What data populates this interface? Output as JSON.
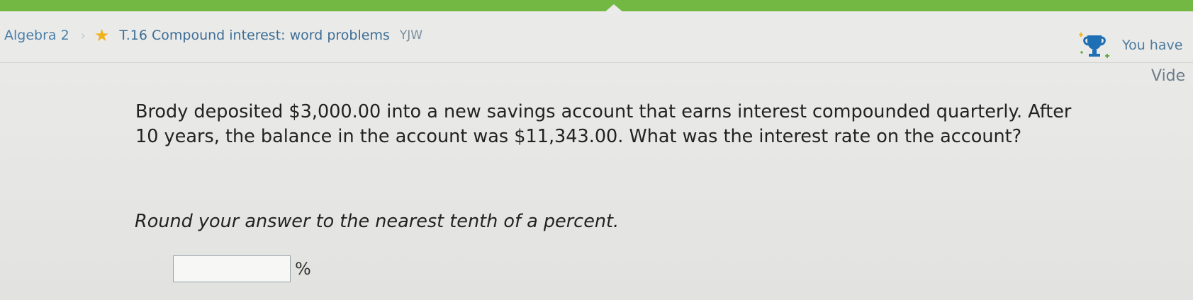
{
  "header": {
    "breadcrumb": {
      "course": "Algebra 2",
      "separator": "›",
      "star_icon": "star-icon",
      "skill": "T.16 Compound interest: word problems",
      "skill_code": "YJW"
    },
    "award_icon": "trophy-icon",
    "you_have_text": "You have",
    "video_text": "Vide"
  },
  "problem": {
    "question": "Brody deposited $3,000.00 into a new savings account that earns interest compounded quarterly. After 10 years, the balance in the account was $11,343.00. What was the interest rate on the account?",
    "instructions": "Round your answer to the nearest tenth of a percent.",
    "answer": {
      "value": "",
      "placeholder": "",
      "unit": "%"
    }
  },
  "colors": {
    "top_bar": "#74b844",
    "breadcrumb_link": "#4a7fa8",
    "star": "#f1b11d",
    "trophy": "#1f6fb5"
  }
}
